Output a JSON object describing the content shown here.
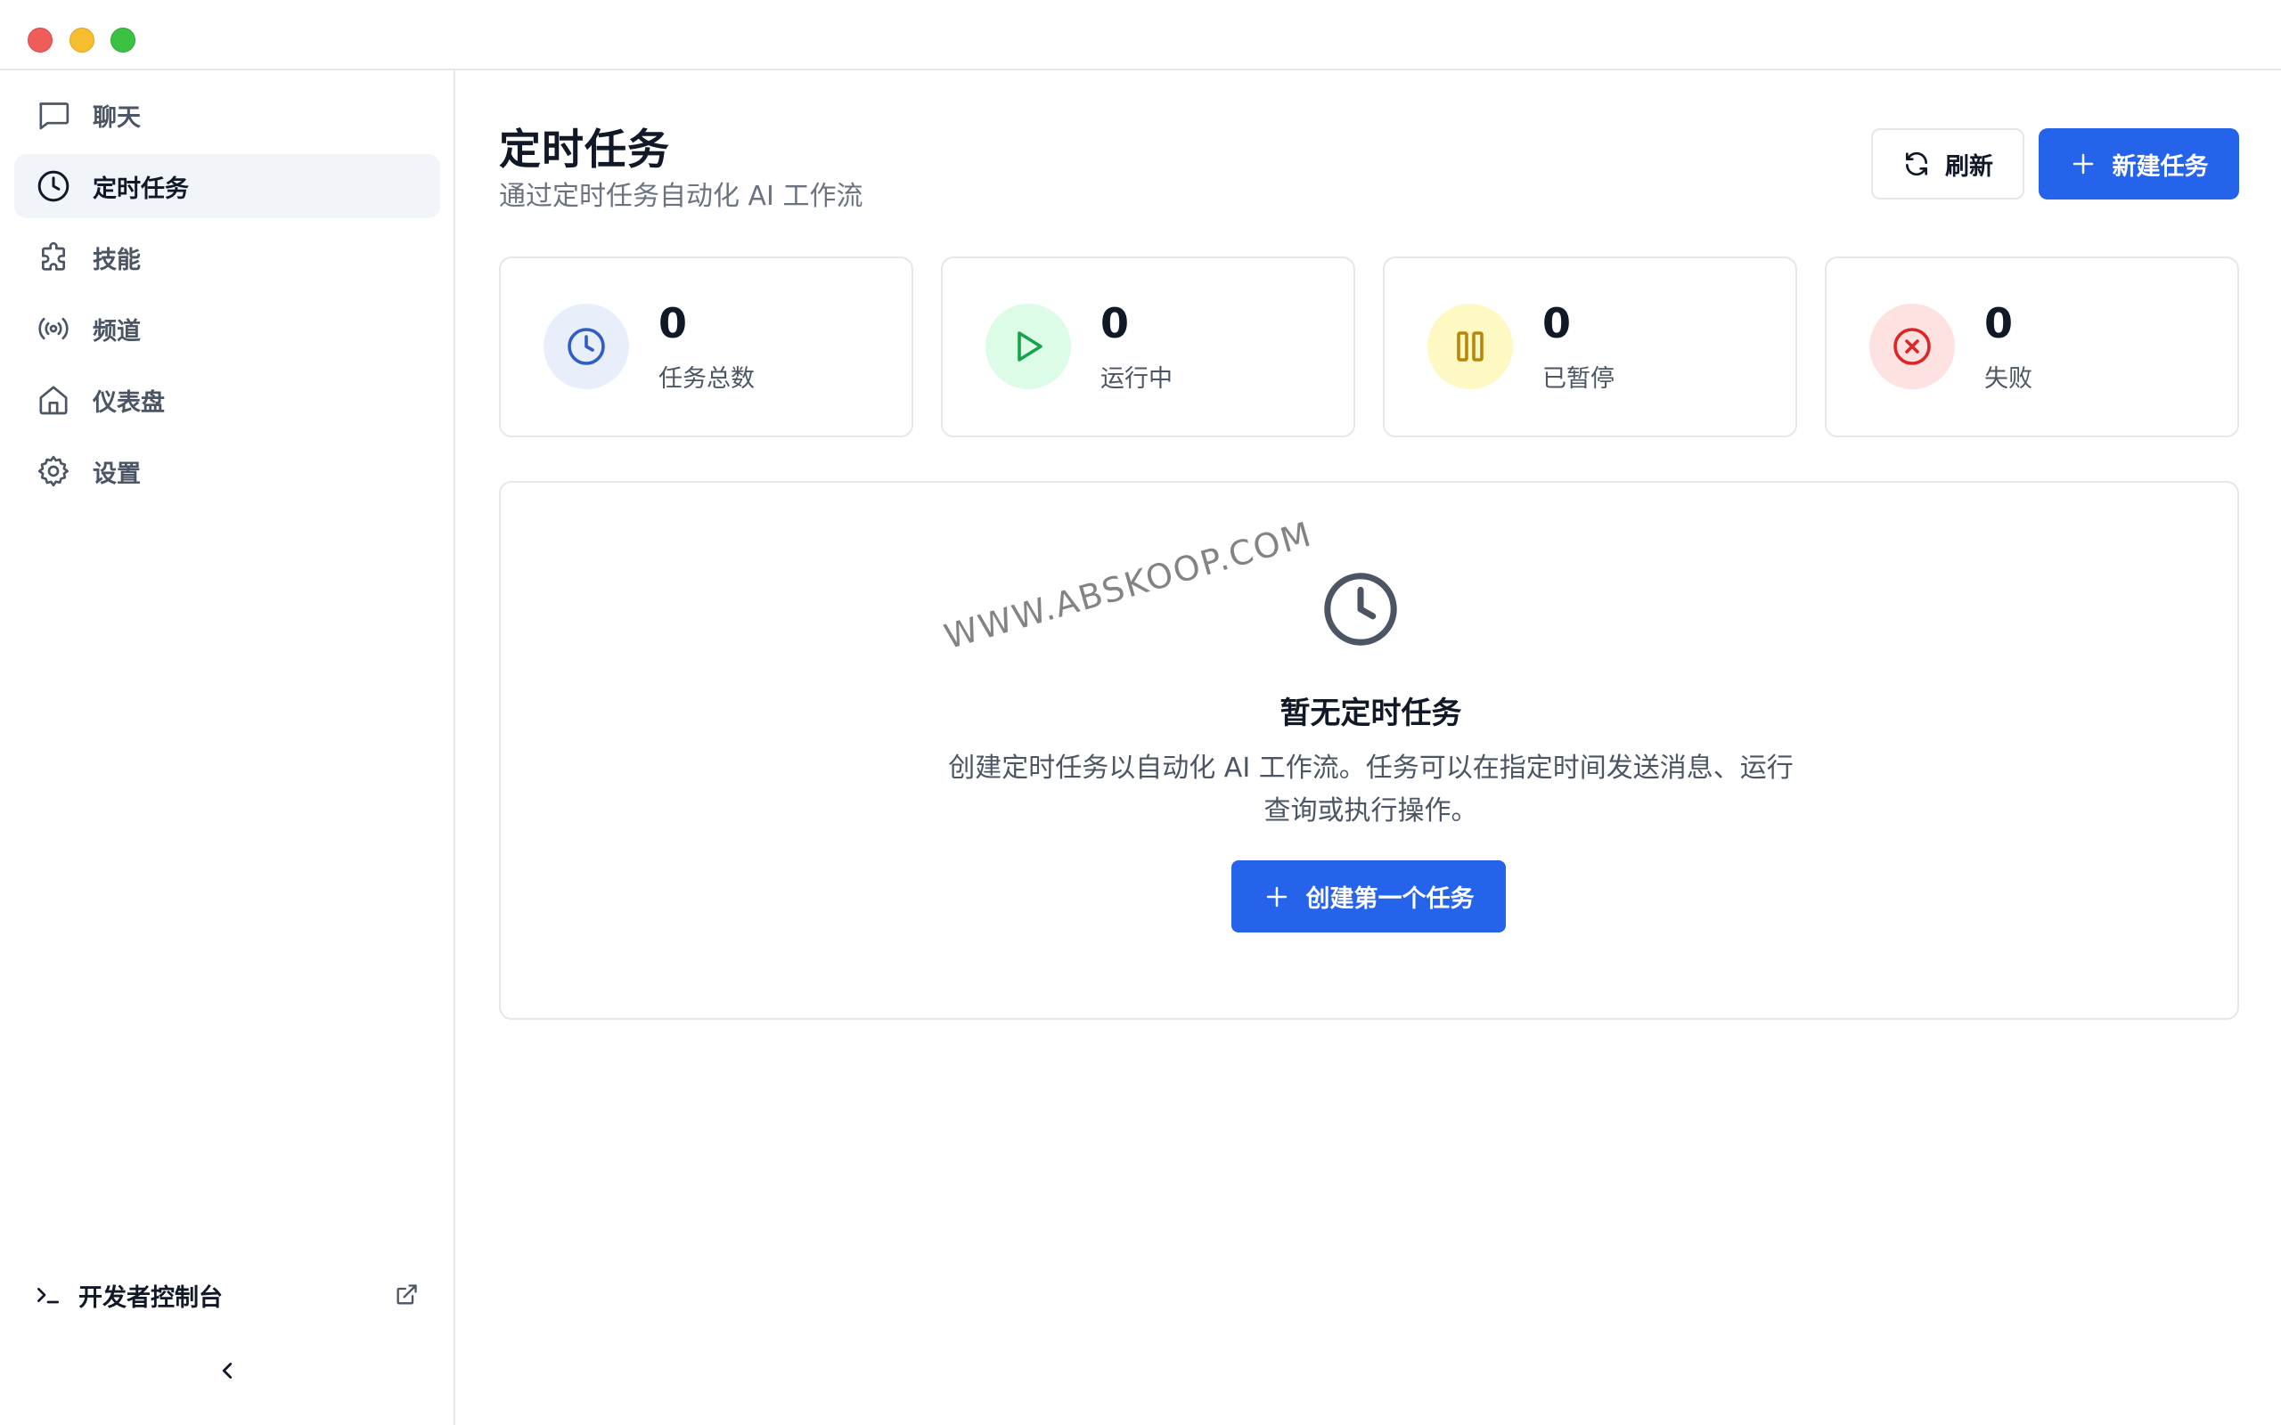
{
  "sidebar": {
    "items": [
      {
        "label": "聊天",
        "icon": "chat-icon",
        "active": false
      },
      {
        "label": "定时任务",
        "icon": "clock-icon",
        "active": true
      },
      {
        "label": "技能",
        "icon": "puzzle-icon",
        "active": false
      },
      {
        "label": "频道",
        "icon": "radio-icon",
        "active": false
      },
      {
        "label": "仪表盘",
        "icon": "home-icon",
        "active": false
      },
      {
        "label": "设置",
        "icon": "gear-icon",
        "active": false
      }
    ],
    "dev_console_label": "开发者控制台"
  },
  "header": {
    "title": "定时任务",
    "subtitle": "通过定时任务自动化 AI 工作流",
    "refresh_label": "刷新",
    "new_task_label": "新建任务"
  },
  "stats": [
    {
      "value": "0",
      "label": "任务总数",
      "icon": "clock-icon",
      "color": "#2f5ec4",
      "bg": "#e8effb"
    },
    {
      "value": "0",
      "label": "运行中",
      "icon": "play-icon",
      "color": "#16a34a",
      "bg": "#dcfce7"
    },
    {
      "value": "0",
      "label": "已暂停",
      "icon": "pause-icon",
      "color": "#b7860b",
      "bg": "#fef9c3"
    },
    {
      "value": "0",
      "label": "失败",
      "icon": "x-circle-icon",
      "color": "#dc2626",
      "bg": "#fee2e2"
    }
  ],
  "empty_state": {
    "title": "暂无定时任务",
    "description": "创建定时任务以自动化 AI 工作流。任务可以在指定时间发送消息、运行查询或执行操作。",
    "button_label": "创建第一个任务"
  },
  "watermark": "WWW.ABSKOOP.COM",
  "colors": {
    "accent": "#2563eb",
    "border": "#e5e7eb",
    "active_nav_bg": "#f1f4f8"
  }
}
